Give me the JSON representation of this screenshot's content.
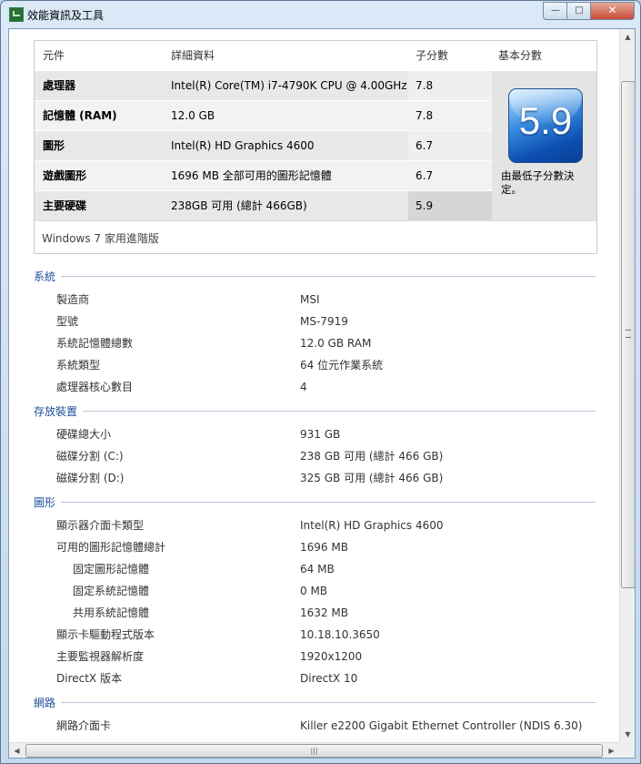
{
  "window": {
    "title": "效能資訊及工具"
  },
  "score_table": {
    "headers": {
      "component": "元件",
      "details": "詳細資料",
      "subscore": "子分數",
      "base_score": "基本分數"
    },
    "rows": [
      {
        "component": "處理器",
        "details": "Intel(R) Core(TM) i7-4790K CPU @ 4.00GHz",
        "subscore": "7.8"
      },
      {
        "component": "記憶體 (RAM)",
        "details": "12.0 GB",
        "subscore": "7.8"
      },
      {
        "component": "圖形",
        "details": "Intel(R) HD Graphics 4600",
        "subscore": "6.7"
      },
      {
        "component": "遊戲圖形",
        "details": "1696 MB 全部可用的圖形記憶體",
        "subscore": "6.7"
      },
      {
        "component": "主要硬碟",
        "details": "238GB 可用 (總計 466GB)",
        "subscore": "5.9"
      }
    ],
    "base_score": "5.9",
    "base_score_note": "由最低子分數決定。",
    "os_edition": "Windows 7 家用進階版"
  },
  "sections": [
    {
      "title": "系統",
      "items": [
        {
          "label": "製造商",
          "value": "MSI"
        },
        {
          "label": "型號",
          "value": "MS-7919"
        },
        {
          "label": "系統記憶體總數",
          "value": "12.0 GB RAM"
        },
        {
          "label": "系統類型",
          "value": "64 位元作業系統"
        },
        {
          "label": "處理器核心數目",
          "value": "4"
        }
      ]
    },
    {
      "title": "存放裝置",
      "items": [
        {
          "label": "硬碟總大小",
          "value": "931 GB"
        },
        {
          "label": "磁碟分割 (C:)",
          "value": "238 GB 可用 (總計 466 GB)"
        },
        {
          "label": "磁碟分割 (D:)",
          "value": "325 GB 可用 (總計 466 GB)"
        }
      ]
    },
    {
      "title": "圖形",
      "items": [
        {
          "label": "顯示器介面卡類型",
          "value": "Intel(R) HD Graphics 4600"
        },
        {
          "label": "可用的圖形記憶體總計",
          "value": "1696 MB"
        },
        {
          "label": "固定圖形記憶體",
          "value": "64 MB"
        },
        {
          "label": "固定系統記憶體",
          "value": "0 MB"
        },
        {
          "label": "共用系統記憶體",
          "value": "1632 MB"
        },
        {
          "label": "顯示卡驅動程式版本",
          "value": "10.18.10.3650"
        },
        {
          "label": "主要監視器解析度",
          "value": "1920x1200"
        },
        {
          "label": "DirectX 版本",
          "value": "DirectX 10"
        }
      ]
    },
    {
      "title": "網路",
      "items": [
        {
          "label": "網路介面卡",
          "value": "Killer e2200 Gigabit Ethernet Controller (NDIS 6.30)"
        }
      ]
    }
  ],
  "icons": {
    "app": "performance-app-icon",
    "minimize": "minimize-icon",
    "maximize": "maximize-icon",
    "close": "close-icon"
  },
  "colors": {
    "section_title": "#1f4d9a",
    "badge": "#1a5fc4",
    "close_button": "#c64a35"
  }
}
